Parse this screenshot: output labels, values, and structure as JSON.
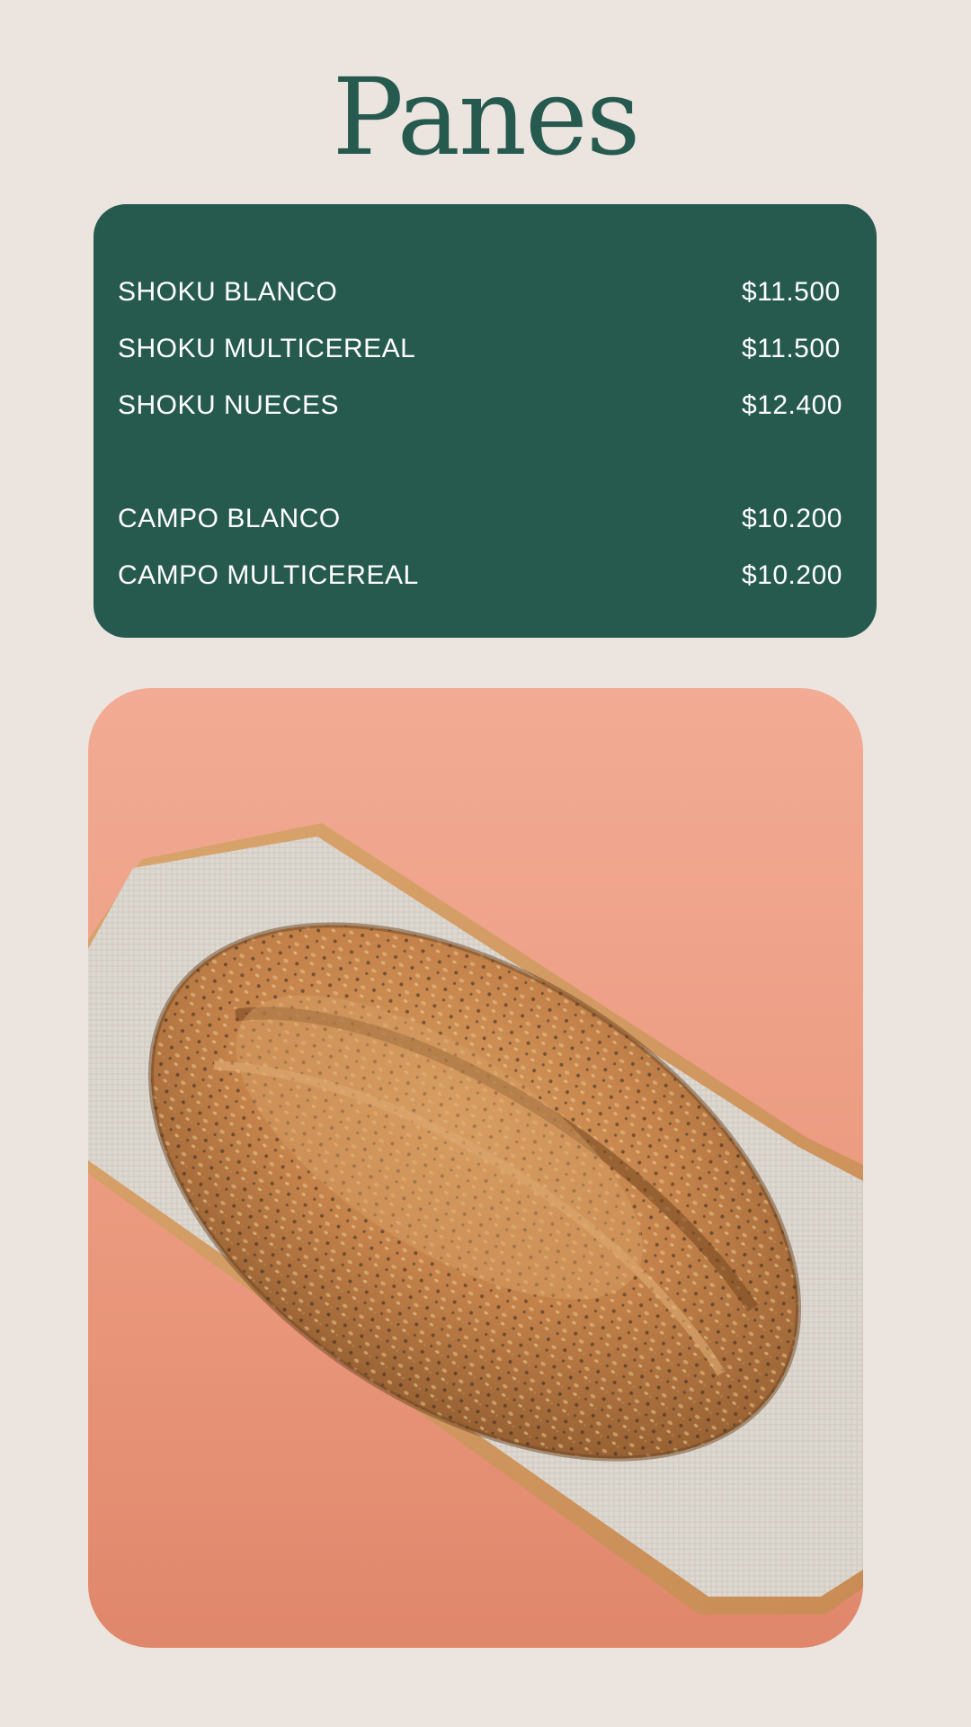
{
  "title": "Panes",
  "menu": {
    "items": [
      {
        "name": "SHOKU BLANCO",
        "price": "$11.500"
      },
      {
        "name": "SHOKU MULTICEREAL",
        "price": "$11.500"
      },
      {
        "name": "SHOKU NUECES",
        "price": "$12.400"
      },
      {
        "name": "CAMPO BLANCO",
        "price": "$10.200"
      },
      {
        "name": "CAMPO MULTICEREAL",
        "price": "$10.200"
      }
    ]
  },
  "colors": {
    "background": "#ebe4df",
    "accent": "#265a4f",
    "photo_background": "#e99a7f"
  },
  "image": {
    "subject": "multigrain-bread-loaf-on-tray"
  }
}
